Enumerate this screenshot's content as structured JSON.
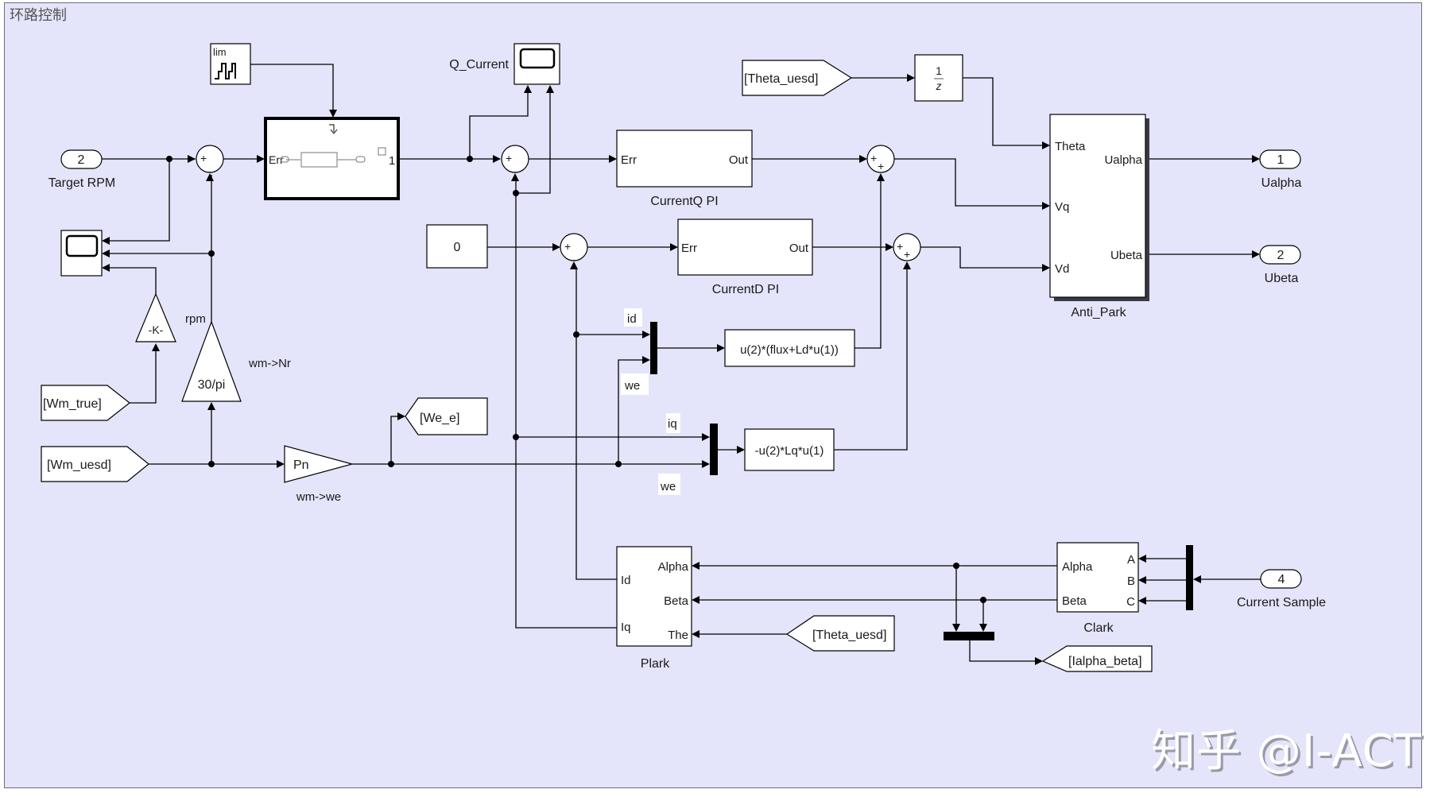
{
  "title": "环路控制",
  "watermark": "知乎 @I-ACT",
  "colors": {
    "canvas_bg": "#e4e4fa",
    "block_fill": "#ffffff",
    "line": "#000000"
  },
  "blocks": {
    "target_rpm": {
      "port": "2",
      "label": "Target RPM"
    },
    "ualpha_out": {
      "port": "1",
      "label": "Ualpha"
    },
    "ubeta_out": {
      "port": "2",
      "label": "Ubeta"
    },
    "current_sample": {
      "port": "4",
      "label": "Current Sample"
    },
    "staircase": {
      "label": "lim"
    },
    "speed_pi": {
      "in_port": "Err",
      "out_port": "1"
    },
    "q_current_scope": {
      "label": "Q_Current"
    },
    "currentq_pi": {
      "in_port": "Err",
      "out_port": "Out",
      "label": "CurrentQ PI"
    },
    "currentd_pi": {
      "in_port": "Err",
      "out_port": "Out",
      "label": "CurrentD PI"
    },
    "constant_zero": {
      "value": "0"
    },
    "theta_from_top": {
      "tag": "[Theta_uesd]"
    },
    "unit_delay": {
      "num": "1",
      "den": "z"
    },
    "anti_park": {
      "label": "Anti_Park",
      "inputs": [
        "Theta",
        "Vq",
        "Vd"
      ],
      "outputs": [
        "Ualpha",
        "Ubeta"
      ]
    },
    "gain_k": {
      "value": "-K-"
    },
    "gain_rpm": {
      "value": "30/pi",
      "signal_label": "rpm",
      "label": "wm->Nr"
    },
    "wm_true": {
      "tag": "[Wm_true]"
    },
    "wm_uesd": {
      "tag": "[Wm_uesd]"
    },
    "gain_pn": {
      "value": "Pn",
      "label": "wm->we"
    },
    "we_e_goto": {
      "tag": "[We_e]"
    },
    "fcn_d": {
      "expr": "u(2)*(flux+Ld*u(1))"
    },
    "fcn_q": {
      "expr": "-u(2)*Lq*u(1)"
    },
    "plark": {
      "label": "Plark",
      "inputs": [
        "Alpha",
        "Beta",
        "The"
      ],
      "outputs": [
        "Id",
        "Iq"
      ]
    },
    "clark": {
      "label": "Clark",
      "inputs": [
        "A",
        "B",
        "C"
      ],
      "outputs": [
        "Alpha",
        "Beta"
      ]
    },
    "theta_from_bottom": {
      "tag": "[Theta_uesd]"
    },
    "ialpha_beta_goto": {
      "tag": "[Ialpha_beta]"
    }
  },
  "signal_labels": {
    "id": "id",
    "we_1": "we",
    "iq": "iq",
    "we_2": "we"
  },
  "sum_signs": {
    "sum_speed": [
      "+",
      "_"
    ],
    "sum_iq": [
      "+",
      "_"
    ],
    "sum_id": [
      "+",
      "_"
    ],
    "sum_vq": [
      "+",
      "+"
    ],
    "sum_vd": [
      "+",
      "+"
    ]
  }
}
